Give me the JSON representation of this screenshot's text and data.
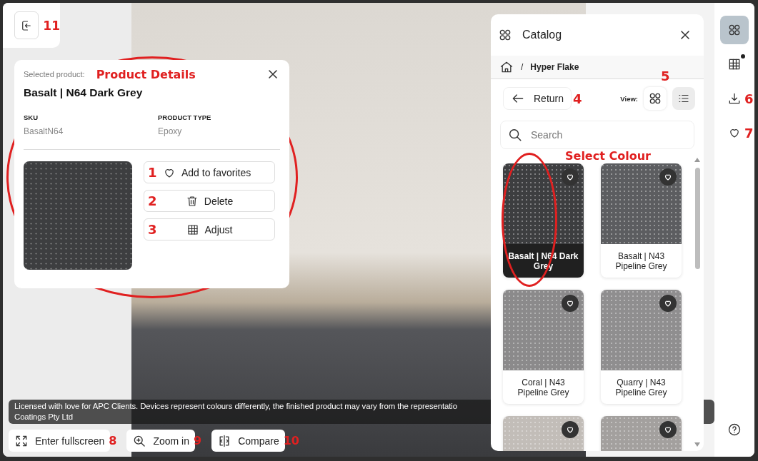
{
  "exit_button": {
    "annotation": "11"
  },
  "product_details": {
    "caption": "Selected product:",
    "annotation": "Product Details",
    "name": "Basalt | N64 Dark Grey",
    "fields": [
      {
        "label": "SKU",
        "value": "BasaltN64"
      },
      {
        "label": "PRODUCT TYPE",
        "value": "Epoxy"
      }
    ],
    "actions": [
      {
        "kind": "favorite",
        "label": "Add to favorites",
        "annotation": "1"
      },
      {
        "kind": "delete",
        "label": "Delete",
        "annotation": "2"
      },
      {
        "kind": "adjust",
        "label": "Adjust",
        "annotation": "3"
      }
    ]
  },
  "catalog": {
    "title": "Catalog",
    "breadcrumb_separator": "/",
    "breadcrumb": [
      "Hyper Flake"
    ],
    "return_label": "Return",
    "return_annotation": "4",
    "view_label": "View:",
    "view_annotation": "5",
    "view_options": [
      {
        "kind": "grid",
        "selected": true
      },
      {
        "kind": "list",
        "selected": false
      }
    ],
    "search": {
      "placeholder": "Search"
    },
    "grid_annotation": "Select Colour",
    "products": [
      {
        "name": "Basalt | N64 Dark Grey",
        "color": "#3d3e40",
        "selected": true
      },
      {
        "name": "Basalt | N43 Pipeline Grey",
        "color": "#5c5d60",
        "selected": false
      },
      {
        "name": "Coral | N43 Pipeline Grey",
        "color": "#8b8a8b",
        "selected": false
      },
      {
        "name": "Quarry | N43 Pipeline Grey",
        "color": "#8f8e8f",
        "selected": false
      },
      {
        "color": "#c2bdb8",
        "selected": false
      },
      {
        "color": "#a3a09e",
        "selected": false
      }
    ]
  },
  "sidebar": [
    {
      "kind": "catalog",
      "selected": true,
      "notification": false
    },
    {
      "kind": "layout",
      "selected": false,
      "notification": true
    },
    {
      "kind": "download",
      "selected": false,
      "notification": false,
      "annotation": "6"
    },
    {
      "kind": "favorites",
      "selected": false,
      "notification": false,
      "annotation": "7"
    }
  ],
  "disclaimer": [
    "Licensed with love for APC Clients. Devices represent colours differently, the finished product may vary from the representatio",
    "Coatings Pty Ltd"
  ],
  "bottom_actions": [
    {
      "kind": "fullscreen",
      "label": "Enter fullscreen",
      "annotation": "8"
    },
    {
      "kind": "zoom",
      "label": "Zoom in",
      "annotation": "9"
    },
    {
      "kind": "compare",
      "label": "Compare",
      "annotation": "10"
    }
  ]
}
